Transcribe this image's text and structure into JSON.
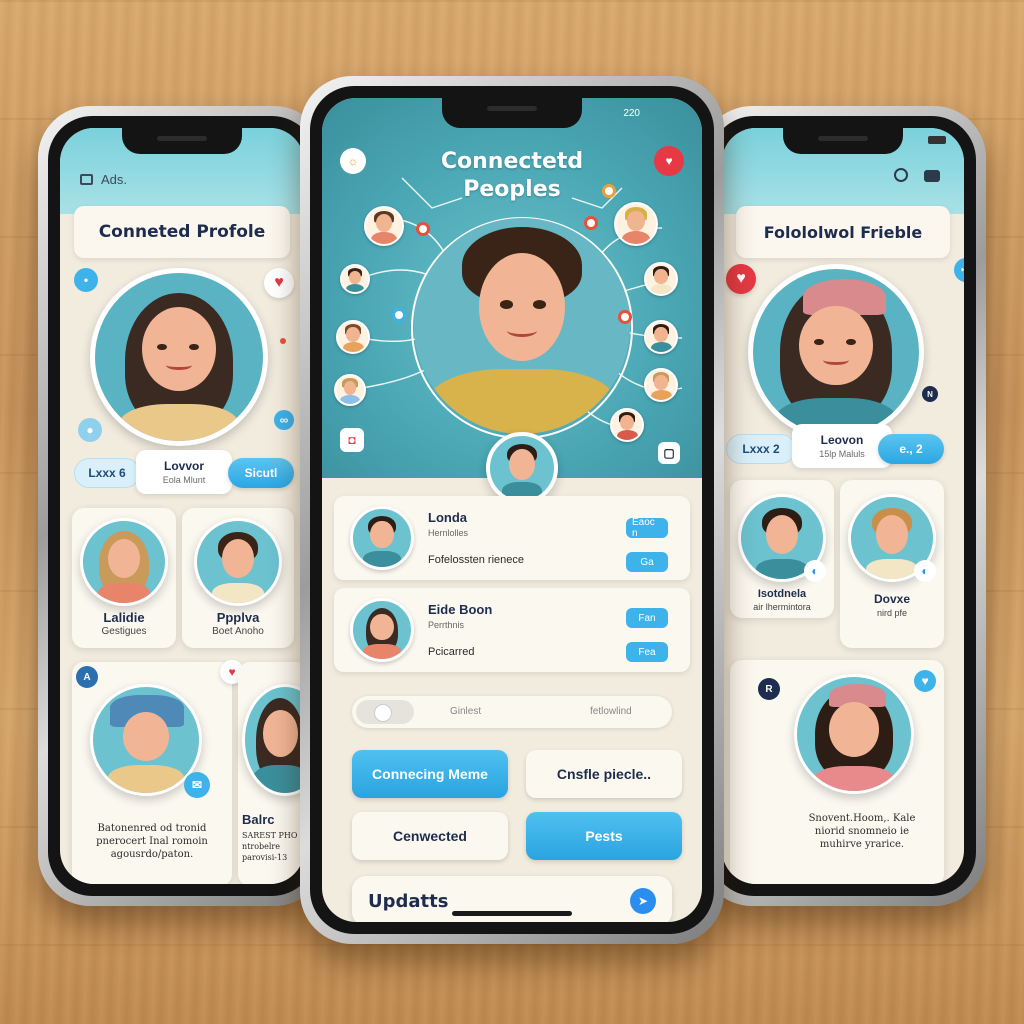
{
  "left": {
    "header_label": "Ads.",
    "title": "Conneted Profole",
    "profile": {
      "name": "Lovvor",
      "sub": "Eola Mlunt"
    },
    "pill_left": "Lxxx 6",
    "pill_right": "Sicutl",
    "cards": [
      {
        "name": "Lalidie",
        "sub": "Gestigues"
      },
      {
        "name": "Ppplva",
        "sub": "Boet Anoho"
      }
    ],
    "post_left": "Batonenred od tronid\npnerocert Inal romoin\nagousrdo/paton.",
    "post_right_title": "Balrc",
    "post_right": "SAREST PHO\nntrobelre\nparovisi-13"
  },
  "center": {
    "status_time": "220",
    "title_line1": "Connectetd",
    "title_line2": "Peoples",
    "list": [
      {
        "name": "Londa",
        "sub": "Hernlolles",
        "text": "Fofelossten rienece",
        "chip1": "Eaoc n",
        "chip2": "Ga"
      },
      {
        "name": "Eide Boon",
        "sub": "Perrthnis",
        "text": "Pcicarred",
        "chip1": "Fan",
        "chip2": "Fea"
      }
    ],
    "search_left": "Ginlest",
    "search_right": "fetlowlind",
    "buttons": {
      "connecting": "Connecing Meme",
      "profile": "Cnsfle piecle..",
      "connected": "Cenwected",
      "posts": "Pests"
    },
    "updates": "Updatts"
  },
  "right": {
    "title": "Folololwol Frieble",
    "profile": {
      "name": "Leovon",
      "sub": "15lp Maluls"
    },
    "pill_left": "Lxxx 2",
    "pill_right": "e., 2",
    "cards": [
      {
        "name": "Isotdnela",
        "sub": "air lhermintora"
      },
      {
        "name": "Dovxe",
        "sub": "nird pfe"
      }
    ],
    "post_text": "Snovent.Hoom,. Kale\nniorid snomneio ie\nmuhirve yrarice."
  },
  "colors": {
    "accent": "#2aa7e4",
    "teal": "#4aa7b4",
    "heart": "#e53945",
    "navy": "#1e2c4d"
  },
  "icons": [
    "heart-icon",
    "search-icon",
    "battery-icon",
    "camera-icon",
    "send-icon"
  ]
}
